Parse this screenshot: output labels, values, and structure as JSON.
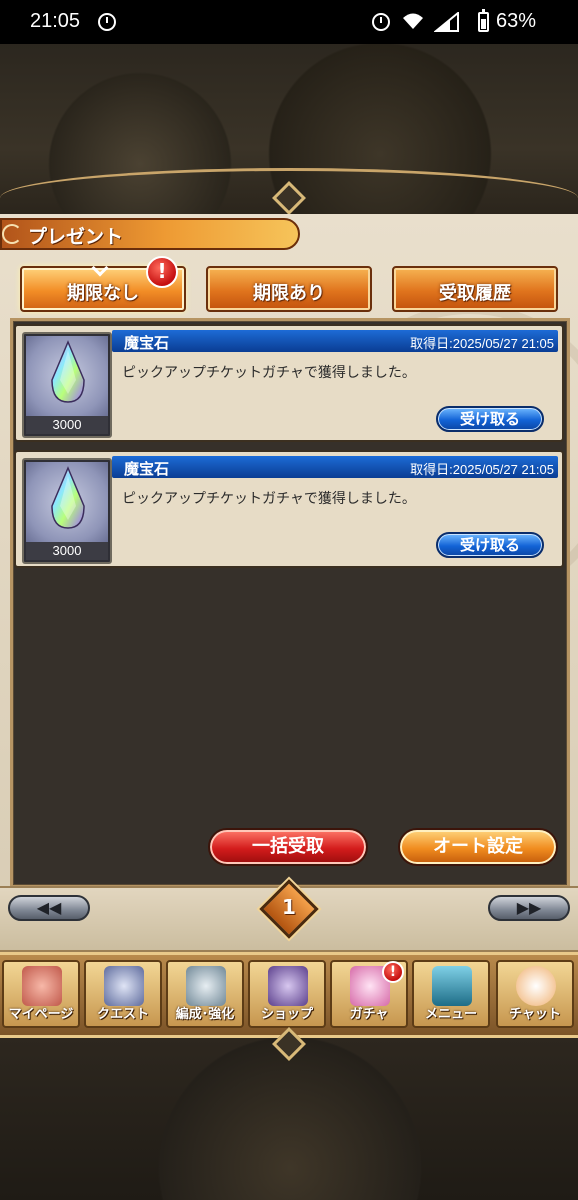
{
  "status_bar": {
    "time": "21:05",
    "battery": "63%"
  },
  "header": {
    "title": "プレゼント"
  },
  "tabs": [
    {
      "label": "期限なし",
      "active": true,
      "alert": "!"
    },
    {
      "label": "期限あり",
      "active": false
    },
    {
      "label": "受取履歴",
      "active": false
    }
  ],
  "items": [
    {
      "name": "魔宝石",
      "date": "取得日:2025/05/27 21:05",
      "description": "ピックアップチケットガチャで獲得しました。",
      "count": "3000",
      "button": "受け取る"
    },
    {
      "name": "魔宝石",
      "date": "取得日:2025/05/27 21:05",
      "description": "ピックアップチケットガチャで獲得しました。",
      "count": "3000",
      "button": "受け取る"
    }
  ],
  "actions": {
    "receive_all": "一括受取",
    "auto_settings": "オート設定"
  },
  "pager": {
    "prev": "◀◀",
    "next": "▶▶",
    "page": "1"
  },
  "nav": [
    {
      "label": "マイページ",
      "icon": "mypage-icon"
    },
    {
      "label": "クエスト",
      "icon": "quest-icon"
    },
    {
      "label": "編成･強化",
      "icon": "party-icon"
    },
    {
      "label": "ショップ",
      "icon": "shop-icon"
    },
    {
      "label": "ガチャ",
      "icon": "gacha-icon",
      "alert": "!"
    },
    {
      "label": "メニュー",
      "icon": "menu-icon"
    },
    {
      "label": "チャット",
      "icon": "chat-icon"
    }
  ],
  "colors": {
    "tab_orange": "#e0741d",
    "title_blue": "#1d6bd6",
    "receive_red": "#d31c1c",
    "alert_red": "#c50f0f"
  }
}
